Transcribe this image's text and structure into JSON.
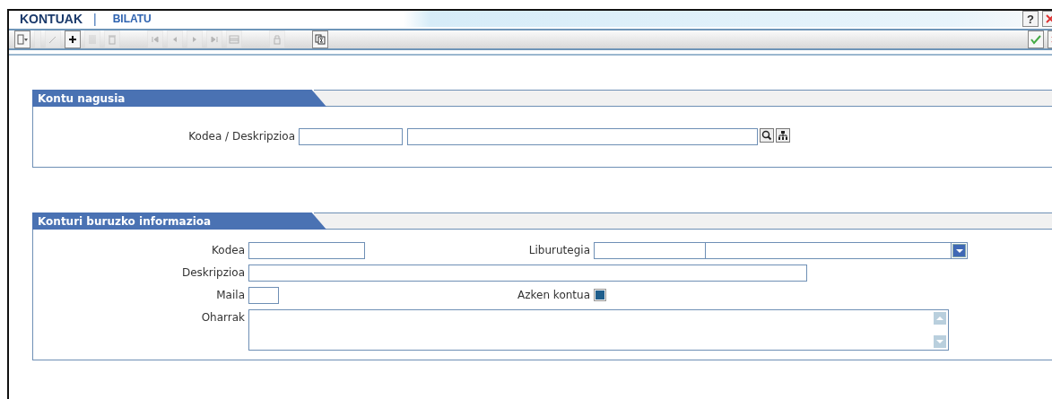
{
  "header": {
    "title": "KONTUAK",
    "separator": "|",
    "subtitle": "BILATU",
    "help": "?"
  },
  "toolbar": [
    [
      {
        "kind": "menu",
        "disabled": false
      },
      {
        "kind": "slider",
        "disabled": true
      },
      {
        "kind": "edit",
        "disabled": true
      },
      {
        "kind": "add",
        "disabled": false
      },
      {
        "kind": "copy",
        "disabled": true
      },
      {
        "kind": "delete",
        "disabled": true
      }
    ],
    [
      {
        "kind": "first",
        "disabled": true
      },
      {
        "kind": "prev",
        "disabled": true
      },
      {
        "kind": "next",
        "disabled": true
      },
      {
        "kind": "last",
        "disabled": true
      },
      {
        "kind": "grid",
        "disabled": true
      }
    ],
    [
      {
        "kind": "print",
        "disabled": true
      }
    ],
    [
      {
        "kind": "sum",
        "disabled": false
      }
    ]
  ],
  "sections": [
    {
      "title": "Kontu nagusia",
      "rows": [
        [
          {
            "kind": "lookup",
            "label": "Kodea / Deskripzioa"
          }
        ]
      ]
    },
    {
      "title": "Konturi buruzko informazioa",
      "rows": [
        [
          {
            "kind": "medium_text",
            "label": "Kodea"
          },
          {
            "kind": "select",
            "label": "Liburutegia"
          }
        ],
        [
          {
            "kind": "long_text",
            "label": "Deskripzioa"
          }
        ],
        [
          {
            "kind": "short_text",
            "label": "Maila"
          },
          {
            "kind": "checkbox",
            "label": "Azken kontua",
            "checked": true
          }
        ],
        [
          {
            "kind": "textarea",
            "label": "Oharrak"
          }
        ]
      ]
    }
  ]
}
